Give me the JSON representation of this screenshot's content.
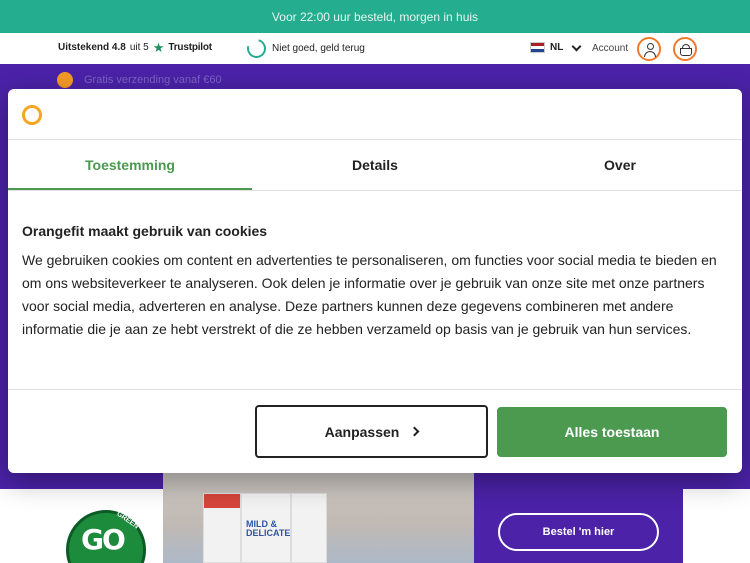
{
  "promo": {
    "text": "Voor 22:00 uur besteld, morgen in huis"
  },
  "utility": {
    "rating_label": "Uitstekend 4.8",
    "rating_suffix": "uit 5",
    "trustpilot": "Trustpilot",
    "guarantee": "Niet goed, geld terug",
    "language": "NL",
    "account": "Account"
  },
  "hero": {
    "ghost_text": "Gratis verzending vanaf €60"
  },
  "cookie_dialog": {
    "tabs": [
      {
        "label": "Toestemming",
        "active": true
      },
      {
        "label": "Details",
        "active": false
      },
      {
        "label": "Over",
        "active": false
      }
    ],
    "title": "Orangefit maakt gebruik van cookies",
    "body": "We gebruiken cookies om content en advertenties te personaliseren, om functies voor social media te bieden en om ons websiteverkeer te analyseren. Ook delen je informatie over je gebruik van onze site met onze partners voor social media, adverteren en analyse. Deze partners kunnen deze gegevens combineren met andere informatie die je aan ze hebt verstrekt of die ze hebben verzameld op basis van je gebruik van hun services.",
    "customize_label": "Aanpassen",
    "allow_label": "Alles toestaan"
  },
  "bottom": {
    "go_green_top": "GREEN",
    "go_green_main": "GO",
    "carton_label": "MILD & DELICATE",
    "order_button": "Bestel 'm hier"
  },
  "colors": {
    "promo_green": "#24ad8e",
    "brand_purple": "#4b22a8",
    "consent_green": "#4b9a4f",
    "brand_orange": "#f07a2a"
  },
  "icons": [
    "trustpilot-star-icon",
    "guarantee-icon",
    "nl-flag-icon",
    "chevron-down-icon",
    "user-icon",
    "basket-icon",
    "orangefit-logo-icon",
    "chevron-right-icon"
  ]
}
